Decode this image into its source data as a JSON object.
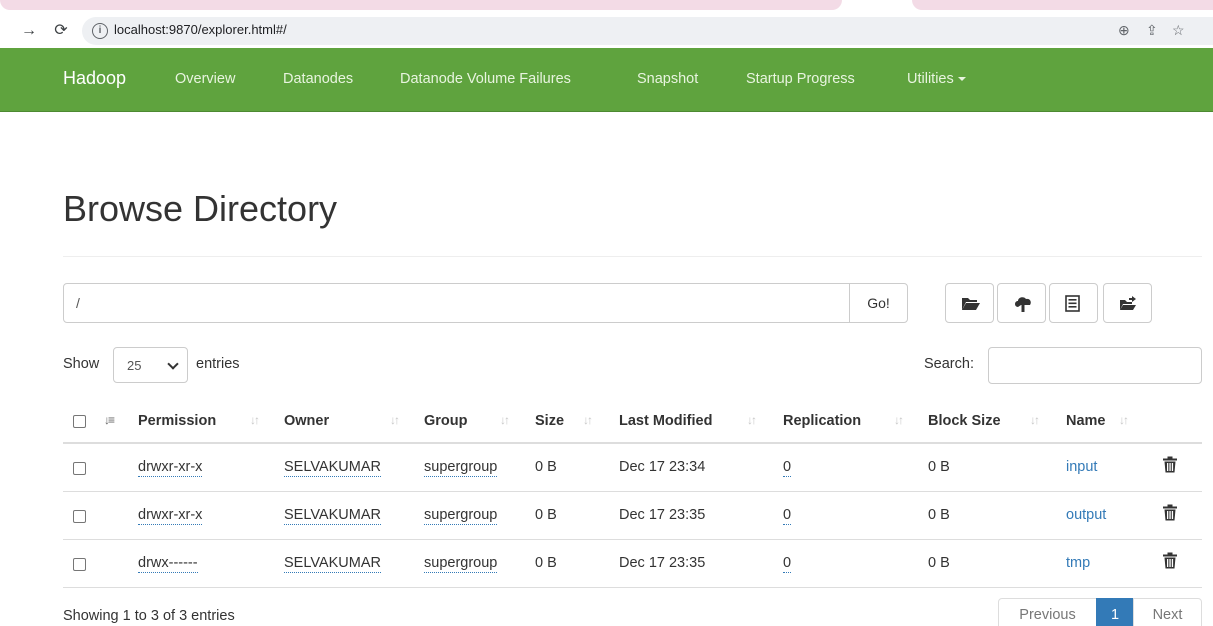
{
  "browser": {
    "url": "localhost:9870/explorer.html#/"
  },
  "navbar": {
    "brand": "Hadoop",
    "links": [
      "Overview",
      "Datanodes",
      "Datanode Volume Failures",
      "Snapshot",
      "Startup Progress",
      "Utilities"
    ]
  },
  "page": {
    "title": "Browse Directory"
  },
  "pathbar": {
    "path": "/",
    "go_label": "Go!"
  },
  "table_controls": {
    "show_label": "Show",
    "entries_value": "25",
    "entries_label": "entries",
    "search_label": "Search:"
  },
  "table": {
    "headers": {
      "permission": "Permission",
      "owner": "Owner",
      "group": "Group",
      "size": "Size",
      "last_modified": "Last Modified",
      "replication": "Replication",
      "block_size": "Block Size",
      "name": "Name"
    },
    "rows": [
      {
        "permission": "drwxr-xr-x",
        "owner": "SELVAKUMAR",
        "group": "supergroup",
        "size": "0 B",
        "last_modified": "Dec 17 23:34",
        "replication": "0",
        "block_size": "0 B",
        "name": "input"
      },
      {
        "permission": "drwxr-xr-x",
        "owner": "SELVAKUMAR",
        "group": "supergroup",
        "size": "0 B",
        "last_modified": "Dec 17 23:35",
        "replication": "0",
        "block_size": "0 B",
        "name": "output"
      },
      {
        "permission": "drwx------",
        "owner": "SELVAKUMAR",
        "group": "supergroup",
        "size": "0 B",
        "last_modified": "Dec 17 23:35",
        "replication": "0",
        "block_size": "0 B",
        "name": "tmp"
      }
    ]
  },
  "footer": {
    "showing": "Showing 1 to 3 of 3 entries",
    "previous": "Previous",
    "current_page": "1",
    "next": "Next"
  },
  "colors": {
    "navbar": "#5fa33e",
    "link": "#337ab7",
    "active_page": "#337ab7"
  }
}
